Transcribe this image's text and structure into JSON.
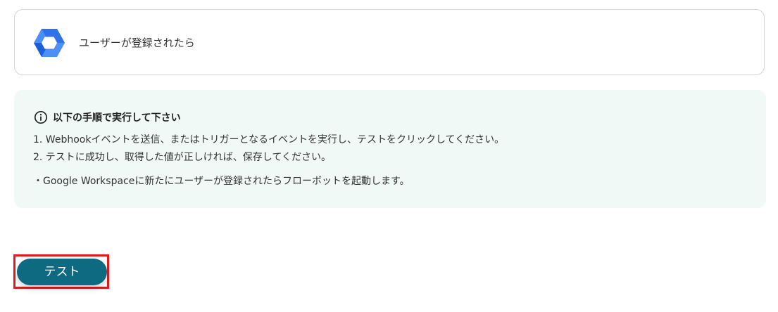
{
  "trigger": {
    "app_icon": "google-workspace-hexagon-icon",
    "label": "ユーザーが登録されたら"
  },
  "instructions": {
    "icon": "info-circle-icon",
    "title": "以下の手順で実行して下さい",
    "steps": [
      "1. Webhookイベントを送信、またはトリガーとなるイベントを実行し、テストをクリックしてください。",
      "2. テストに成功し、取得した値が正しければ、保存してください。"
    ],
    "note": "・Google Workspaceに新たにユーザーが登録されたらフローボットを起動します。"
  },
  "actions": {
    "test_label": "テスト"
  },
  "colors": {
    "accent": "#0d6a80",
    "info_background": "#f1f9f7",
    "highlight": "#e01b1b",
    "icon_blue_dark": "#1a5fd6",
    "icon_blue_light": "#4e8ef7"
  }
}
